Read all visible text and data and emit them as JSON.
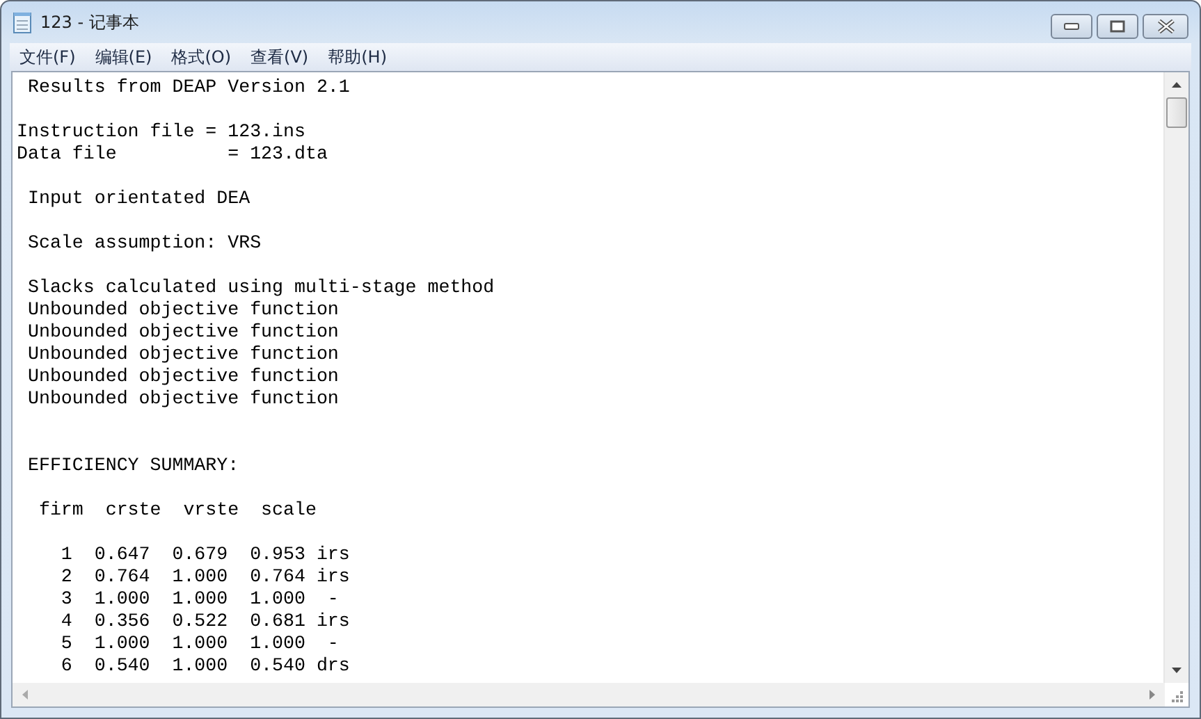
{
  "window": {
    "title": "123 - 记事本"
  },
  "menu": [
    "文件(F)",
    "编辑(E)",
    "格式(O)",
    "查看(V)",
    "帮助(H)"
  ],
  "document": [
    {
      "kind": "block",
      "lines": [
        " Results from DEAP Version 2.1"
      ]
    },
    {
      "kind": "block",
      "lines": [
        "Instruction file = 123.ins",
        "Data file          = 123.dta"
      ]
    },
    {
      "kind": "block",
      "lines": [
        " Input orientated DEA"
      ]
    },
    {
      "kind": "block",
      "lines": [
        " Scale assumption: VRS"
      ]
    },
    {
      "kind": "block",
      "lines": [
        " Slacks calculated using multi-stage method",
        " Unbounded objective function",
        " Unbounded objective function",
        " Unbounded objective function",
        " Unbounded objective function",
        " Unbounded objective function"
      ]
    },
    {
      "kind": "section",
      "lines": [
        " EFFICIENCY SUMMARY:"
      ]
    },
    {
      "kind": "block",
      "lines": [
        "  firm  crste  vrste  scale"
      ]
    },
    {
      "kind": "block",
      "lines": [
        "    1  0.647  0.679  0.953 irs",
        "    2  0.764  1.000  0.764 irs",
        "    3  1.000  1.000  1.000  -",
        "    4  0.356  0.522  0.681 irs",
        "    5  1.000  1.000  1.000  -",
        "    6  0.540  1.000  0.540 drs"
      ]
    }
  ]
}
